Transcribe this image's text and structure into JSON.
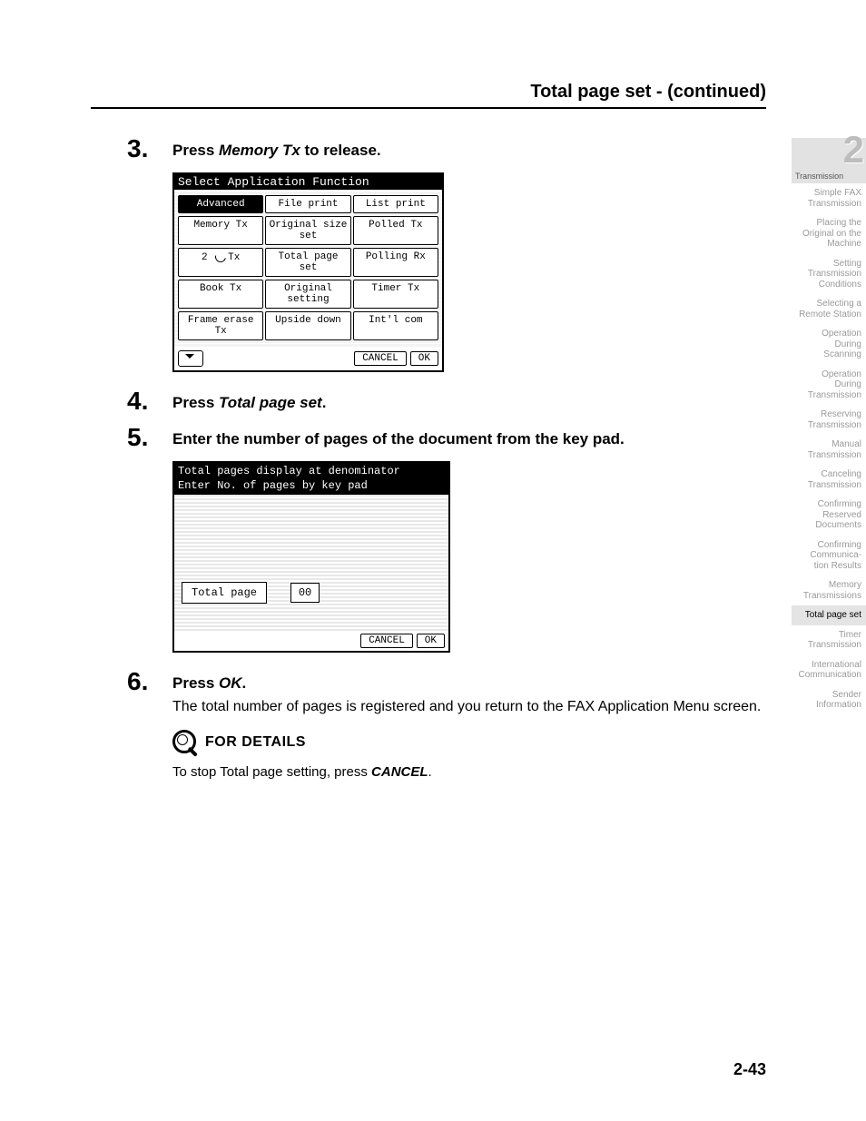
{
  "header": {
    "title": "Total page set -  (continued)"
  },
  "steps": {
    "s3": {
      "num": "3.",
      "title_pre": "Press ",
      "title_em": "Memory Tx",
      "title_post": " to release."
    },
    "s4": {
      "num": "4.",
      "title_pre": "Press ",
      "title_em": "Total page set",
      "title_post": "."
    },
    "s5": {
      "num": "5.",
      "text": "Enter the number of pages of the document from the key pad."
    },
    "s6": {
      "num": "6.",
      "title_pre": "Press ",
      "title_em": "OK",
      "title_post": ".",
      "body": "The total number of pages is registered and you return to the FAX Application Menu screen."
    }
  },
  "scr1": {
    "header": "Select Application Function",
    "rows": [
      [
        "Advanced",
        "File print",
        "List print"
      ],
      [
        "Memory Tx",
        "Original size set",
        "Polled Tx"
      ],
      [
        "2      Tx",
        "Total page set",
        "Polling Rx"
      ],
      [
        "Book Tx",
        "Original setting",
        "Timer Tx"
      ],
      [
        "Frame erase Tx",
        "Upside down",
        "Int'l com"
      ]
    ],
    "cancel": "CANCEL",
    "ok": "OK"
  },
  "scr2": {
    "line1": "Total pages display at denominator",
    "line2": "Enter No. of pages by key pad",
    "label": "Total page",
    "value": "00",
    "cancel": "CANCEL",
    "ok": "OK"
  },
  "details": {
    "label": "FOR DETAILS",
    "text_pre": "To stop Total page setting, press ",
    "text_em": "CANCEL",
    "text_post": "."
  },
  "page_number": "2-43",
  "sidebar": {
    "chapter_num": "2",
    "chapter_label": "Transmission",
    "items": [
      "Simple FAX Transmission",
      "Placing the Original on the Machine",
      "Setting Transmission Conditions",
      "Selecting a Remote Station",
      "Operation During Scanning",
      "Operation During Transmission",
      "Reserving Transmission",
      "Manual Transmission",
      "Canceling Transmission",
      "Confirming Reserved Documents",
      "Confirming Communica- tion Results",
      "Memory Transmissions",
      "Total page set",
      "Timer Transmission",
      "International Communication",
      "Sender Information"
    ],
    "active_index": 12
  }
}
